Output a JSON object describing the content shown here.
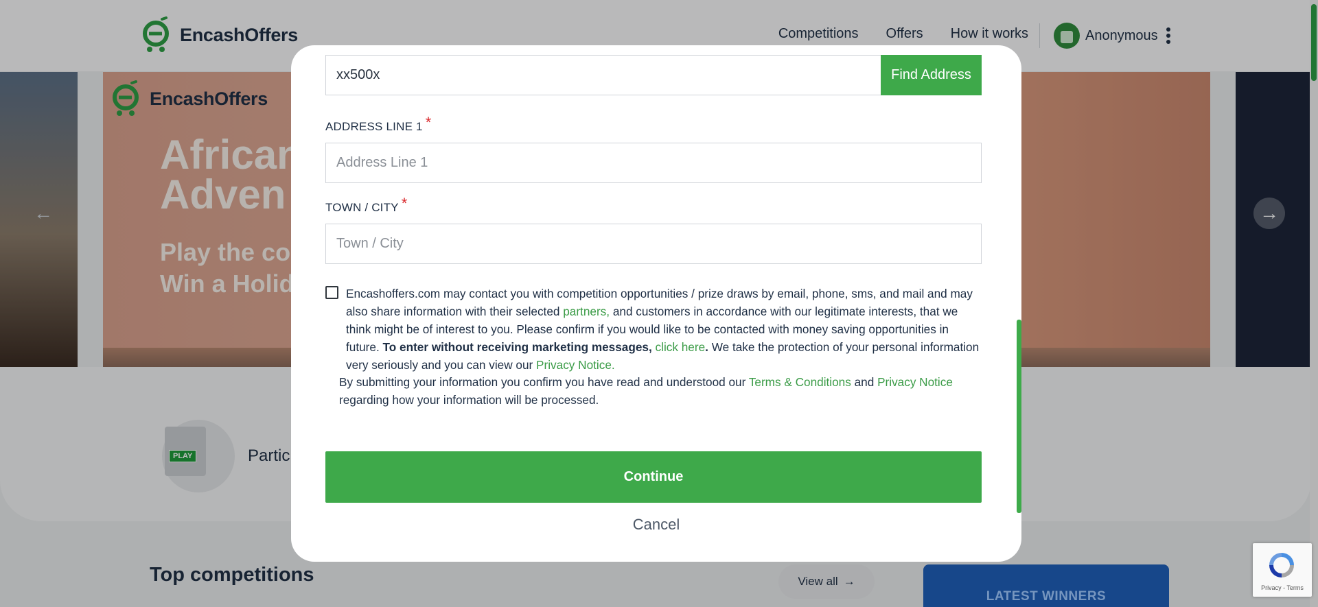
{
  "header": {
    "brand": "EncashOffers",
    "nav": [
      "Competitions",
      "Offers",
      "How it works"
    ],
    "user_name": "Anonymous"
  },
  "banner": {
    "brand": "EncashOffers",
    "headline_1": "African",
    "headline_2": "Adven",
    "sub_1": "Play the co",
    "sub_2": "Win a Holid"
  },
  "card": {
    "play_tag": "PLAY",
    "partic_text": "Partic"
  },
  "sections": {
    "top_competitions": "Top competitions",
    "view_all": "View all",
    "latest_winners": "LATEST WINNERS"
  },
  "modal": {
    "postcode_value": "xx500x",
    "find_address": "Find Address",
    "address_line_1_label": "ADDRESS LINE 1",
    "address_line_1_placeholder": "Address Line 1",
    "town_city_label": "TOWN / CITY",
    "town_city_placeholder": "Town / City",
    "required_mark": "*",
    "consent": {
      "p1": "Encashoffers.com may contact you with competition opportunities / prize draws by email, phone, sms, and mail and may also share information with their selected ",
      "partners_link": "partners,",
      "p2": " and customers in accordance with our legitimate interests, that we think might be of interest to you. Please confirm if you would like to be contacted with money saving opportunities in future. ",
      "bold": "To enter without receiving marketing messages,",
      "click_here": "click here",
      "p3_bold": ".",
      "p4": " We take the protection of your personal information very seriously and you can view our ",
      "privacy_link": "Privacy Notice."
    },
    "submit_note": {
      "p1": "By submitting your information you confirm you have read and understood our ",
      "terms_link": "Terms & Conditions",
      "and": " and ",
      "privacy_link": "Privacy Notice",
      "p2": " regarding how your information will be processed."
    },
    "continue": "Continue",
    "cancel": "Cancel"
  },
  "recaptcha": {
    "privacy": "Privacy",
    "sep": " - ",
    "terms": "Terms"
  },
  "colors": {
    "brand_green": "#3ea94a",
    "link_green": "#3a9b46",
    "required_red": "#d9262a",
    "text_dark": "#1f2f45"
  },
  "icons": [
    "logo-icon",
    "avatar-icon",
    "kebab-menu-icon",
    "arrow-left-icon",
    "arrow-right-icon",
    "play-document-icon",
    "arrow-right-small-icon",
    "recaptcha-icon"
  ]
}
